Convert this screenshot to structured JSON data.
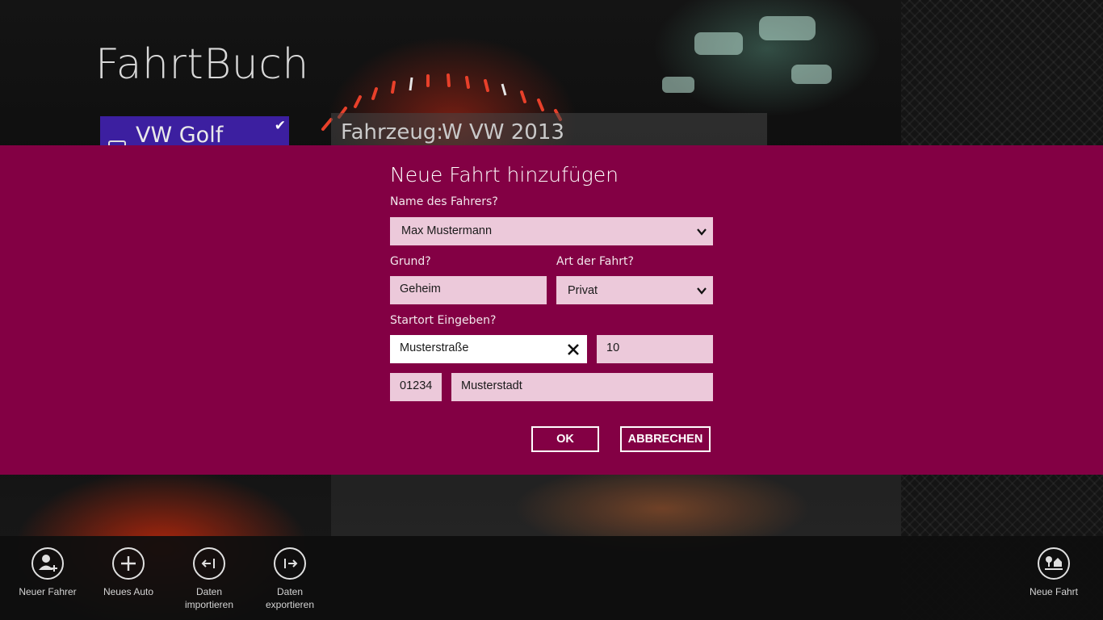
{
  "app": {
    "title": "FahrtBuch"
  },
  "background": {
    "selected_car": "VW Golf",
    "vehicle_label": "Fahrzeug:",
    "vehicle_value": "W VW 2013"
  },
  "dialog": {
    "title": "Neue Fahrt hinzufügen",
    "accent_color": "#830044",
    "driver_label": "Name des Fahrers?",
    "driver_value": "Max Mustermann",
    "reason_label": "Grund?",
    "reason_value": "Geheim",
    "trip_type_label": "Art der Fahrt?",
    "trip_type_value": "Privat",
    "start_label": "Startort Eingeben?",
    "street_value": "Musterstraße",
    "house_number_value": "10",
    "zip_value": "01234",
    "city_value": "Musterstadt",
    "ok_label": "OK",
    "cancel_label": "ABBRECHEN"
  },
  "appbar": {
    "left": [
      {
        "label_line1": "Neuer Fahrer",
        "label_line2": "",
        "icon": "add-person-icon"
      },
      {
        "label_line1": "Neues Auto",
        "label_line2": "",
        "icon": "plus-icon"
      },
      {
        "label_line1": "Daten",
        "label_line2": "importieren",
        "icon": "import-icon"
      },
      {
        "label_line1": "Daten",
        "label_line2": "exportieren",
        "icon": "export-icon"
      }
    ],
    "right": {
      "label_line1": "Neue Fahrt",
      "icon": "new-trip-icon"
    }
  }
}
